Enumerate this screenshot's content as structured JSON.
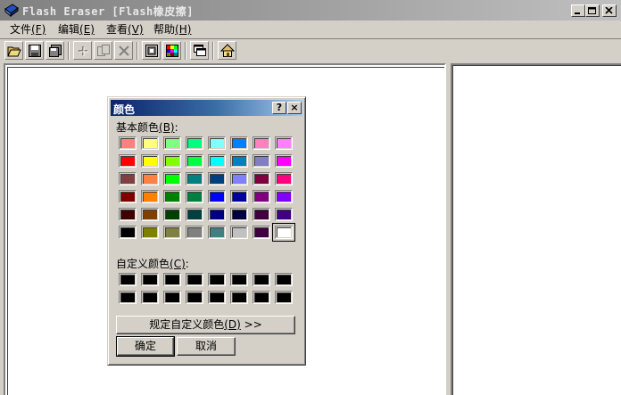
{
  "window": {
    "title": "Flash Eraser [Flash橡皮擦]",
    "controls": {
      "minimize": "_",
      "maximize": "□",
      "close": "×"
    }
  },
  "menu": [
    {
      "label": "文件",
      "accel": "(F)"
    },
    {
      "label": "编辑",
      "accel": "(E)"
    },
    {
      "label": "查看",
      "accel": "(V)"
    },
    {
      "label": "帮助",
      "accel": "(H)"
    }
  ],
  "toolbar": {
    "buttons": [
      "open-icon",
      "save-icon",
      "save-as-icon",
      "add-icon",
      "copy-icon",
      "delete-icon",
      "preview-icon",
      "color-icon",
      "window-icon",
      "home-icon"
    ]
  },
  "color_dialog": {
    "title": "颜色",
    "help_label": "?",
    "close_label": "×",
    "basic_colors_label": "基本颜色",
    "basic_colors_accel": "(B)",
    "basic_colors_suffix": ":",
    "custom_colors_label": "自定义颜色",
    "custom_colors_accel": "(C)",
    "custom_colors_suffix": ":",
    "define_custom_label": "规定自定义颜色",
    "define_custom_accel": "(D)",
    "define_custom_suffix": " >>",
    "ok_label": "确定",
    "cancel_label": "取消",
    "basic_colors": [
      [
        "#ff8080",
        "#ffff80",
        "#80ff80",
        "#00ff80",
        "#80ffff",
        "#0080ff",
        "#ff80c0",
        "#ff80ff"
      ],
      [
        "#ff0000",
        "#ffff00",
        "#80ff00",
        "#00ff40",
        "#00ffff",
        "#0080c0",
        "#8080c0",
        "#ff00ff"
      ],
      [
        "#804040",
        "#ff8040",
        "#00ff00",
        "#008080",
        "#004080",
        "#8080ff",
        "#800040",
        "#ff0080"
      ],
      [
        "#800000",
        "#ff8000",
        "#008000",
        "#008040",
        "#0000ff",
        "#0000a0",
        "#800080",
        "#8000ff"
      ],
      [
        "#400000",
        "#804000",
        "#004000",
        "#004040",
        "#000080",
        "#000040",
        "#400040",
        "#400080"
      ],
      [
        "#000000",
        "#808000",
        "#808040",
        "#808080",
        "#408080",
        "#c0c0c0",
        "#400040",
        "#ffffff"
      ]
    ],
    "selected_basic": [
      5,
      7
    ],
    "custom_colors": [
      [
        "#000000",
        "#000000",
        "#000000",
        "#000000",
        "#000000",
        "#000000",
        "#000000",
        "#000000"
      ],
      [
        "#000000",
        "#000000",
        "#000000",
        "#000000",
        "#000000",
        "#000000",
        "#000000",
        "#000000"
      ]
    ]
  }
}
